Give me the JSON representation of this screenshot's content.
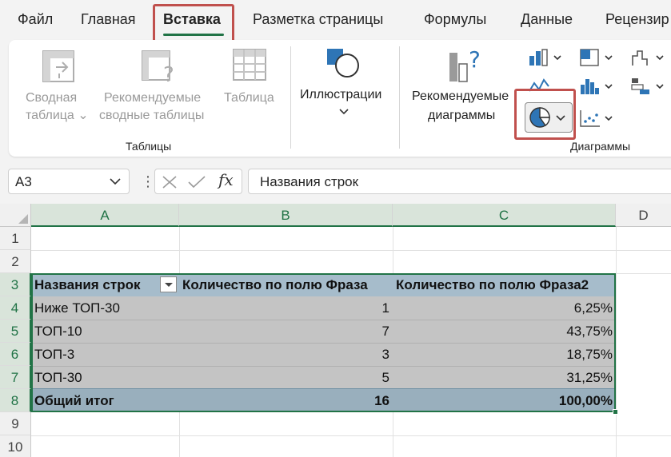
{
  "tabs": [
    "Файл",
    "Главная",
    "Вставка",
    "Разметка страницы",
    "Формулы",
    "Данные",
    "Рецензир"
  ],
  "ribbon": {
    "tables_group": {
      "name": "Таблицы",
      "pivot_line1": "Сводная",
      "pivot_line2": "таблица",
      "recommended_line1": "Рекомендуемые",
      "recommended_line2": "сводные таблицы",
      "table": "Таблица"
    },
    "illustrations": "Иллюстрации",
    "charts_group": {
      "name": "Диаграммы",
      "recommended_line1": "Рекомендуемые",
      "recommended_line2": "диаграммы"
    }
  },
  "formula_bar": {
    "name_box": "A3",
    "formula": "Названия строк"
  },
  "columns": [
    "A",
    "B",
    "C",
    "D"
  ],
  "rows": [
    "1",
    "2",
    "3",
    "4",
    "5",
    "6",
    "7",
    "8",
    "9",
    "10"
  ],
  "pivot": {
    "headers": [
      "Названия строк",
      "Количество по полю Фраза",
      "Количество по полю Фраза2"
    ],
    "data": [
      [
        "Ниже ТОП-30",
        "1",
        "6,25%"
      ],
      [
        "ТОП-10",
        "7",
        "43,75%"
      ],
      [
        "ТОП-3",
        "3",
        "18,75%"
      ],
      [
        "ТОП-30",
        "5",
        "31,25%"
      ]
    ],
    "total": [
      "Общий итог",
      "16",
      "100,00%"
    ]
  },
  "colors": {
    "accent": "#217346",
    "highlight": "#c0504d",
    "pivot_header": "#a6bccb",
    "pivot_body": "#c4c4c4",
    "pivot_total": "#99afbd"
  }
}
